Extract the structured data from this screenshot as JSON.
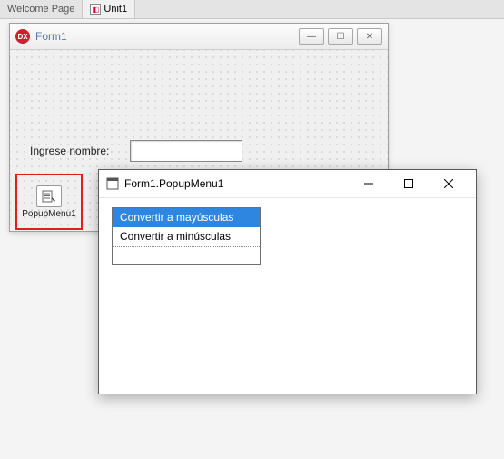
{
  "tabs": {
    "welcome": "Welcome Page",
    "unit": "Unit1"
  },
  "form": {
    "caption": "Form1",
    "label_ingrese": "Ingrese nombre:",
    "popup_component": "PopupMenu1"
  },
  "winctl": {
    "min": "—",
    "max": "☐",
    "close": "✕"
  },
  "editor": {
    "title": "Form1.PopupMenu1",
    "items": [
      "Convertir a mayúsculas",
      "Convertir a minúsculas"
    ],
    "selected_index": 0
  }
}
